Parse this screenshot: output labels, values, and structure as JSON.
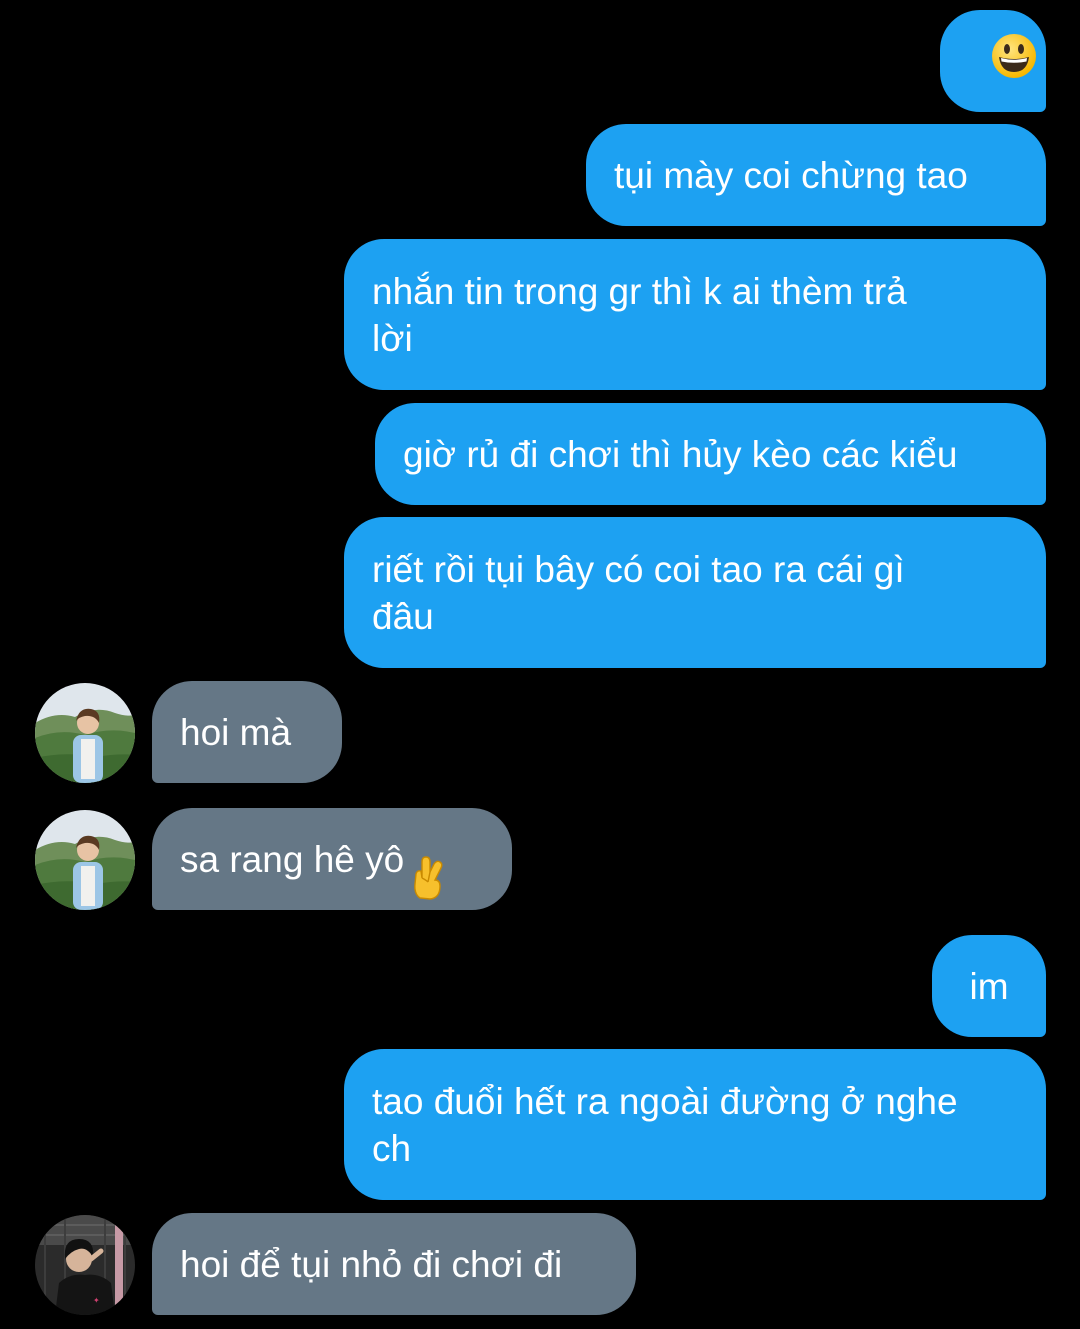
{
  "conversation": {
    "messages": [
      {
        "id": "m1",
        "side": "out",
        "text": "",
        "emoji": "grinning-face-emoji"
      },
      {
        "id": "m2",
        "side": "out",
        "text": "tụi mày coi chừng tao"
      },
      {
        "id": "m3",
        "side": "out",
        "text": "nhắn tin trong gr thì k ai thèm trả\nlời"
      },
      {
        "id": "m4",
        "side": "out",
        "text": "giờ rủ đi chơi thì hủy kèo các kiểu"
      },
      {
        "id": "m5",
        "side": "out",
        "text": "riết rồi tụi bây có coi tao ra cái gì\nđâu"
      },
      {
        "id": "m6",
        "side": "in",
        "text": "hoi mà",
        "avatar": "avatar-hill-boy"
      },
      {
        "id": "m7",
        "side": "in",
        "text": "sa rang hê yô ",
        "emoji": "crossed-fingers-heart-emoji",
        "avatar": "avatar-hill-boy"
      },
      {
        "id": "m8",
        "side": "out",
        "text": "im"
      },
      {
        "id": "m9",
        "side": "out",
        "text": "tao đuổi hết ra ngoài đường ở nghe\nch"
      },
      {
        "id": "m10",
        "side": "in",
        "text": "hoi để tụi nhỏ đi chơi đi",
        "avatar": "avatar-dark-photo"
      }
    ]
  },
  "colors": {
    "background": "#000000",
    "outgoing_bubble": "#1da1f2",
    "incoming_bubble": "#657786",
    "text": "#ffffff"
  }
}
